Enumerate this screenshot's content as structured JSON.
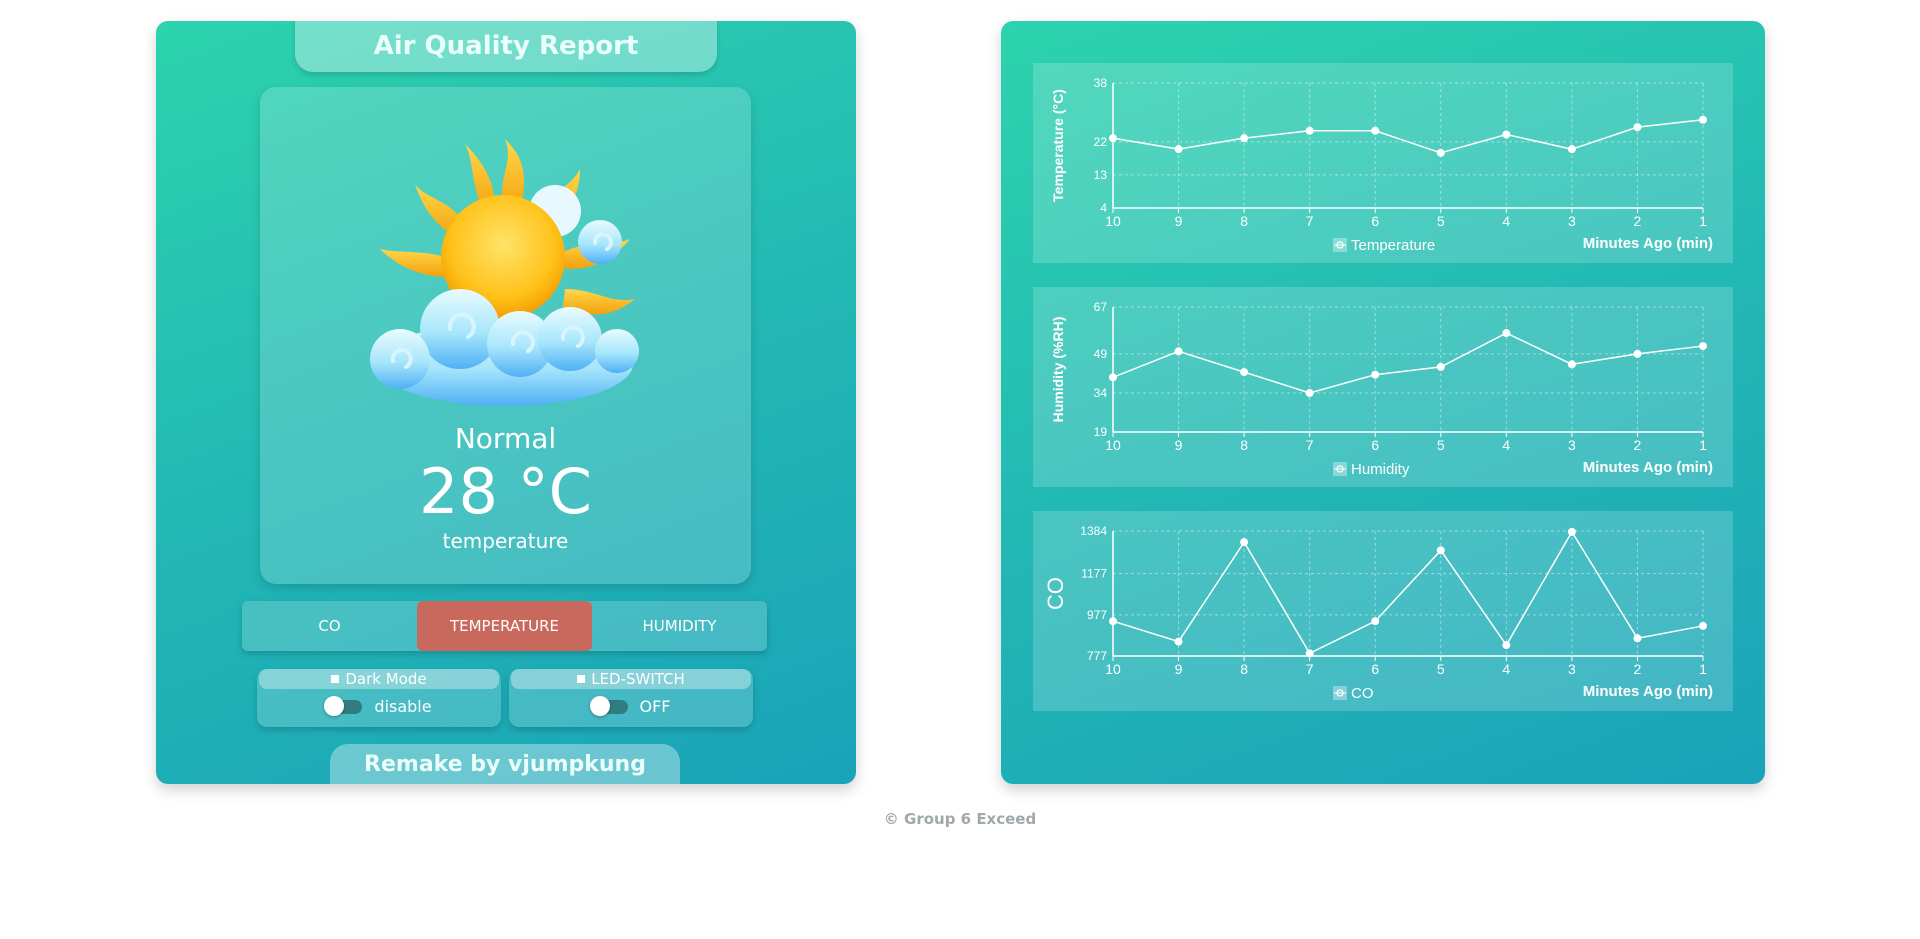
{
  "header": {
    "title": "Air Quality Report"
  },
  "weather": {
    "status": "Normal",
    "value": "28 °C",
    "label": "temperature",
    "icon": "sun-behind-cloud-icon"
  },
  "mode_tabs": [
    {
      "label": "CO",
      "active": false
    },
    {
      "label": "TEMPERATURE",
      "active": true
    },
    {
      "label": "HUMIDITY",
      "active": false
    }
  ],
  "switches": {
    "dark_mode": {
      "label": "Dark Mode",
      "state": "disable"
    },
    "led": {
      "label": "LED-SWITCH",
      "state": "OFF"
    }
  },
  "footer": {
    "label": "Remake by vjumpkung"
  },
  "copyright": "© Group 6 Exceed",
  "colors": {
    "panel_start": "#2dd3ae",
    "panel_end": "#1aa3b9",
    "active_tab": "#c9695d"
  },
  "chart_data": [
    {
      "type": "line",
      "x": [
        10,
        9,
        8,
        7,
        6,
        5,
        4,
        3,
        2,
        1
      ],
      "xlabel": "Minutes Ago (min)",
      "ylabel": "Temperature (°C)",
      "yticks": [
        4,
        13,
        22,
        38
      ],
      "ylim": [
        4,
        38
      ],
      "grid": true,
      "legend": "bottom-center",
      "series": [
        {
          "name": "Temperature",
          "values": [
            23,
            20,
            23,
            25,
            25,
            19,
            24,
            20,
            26,
            28
          ]
        }
      ]
    },
    {
      "type": "line",
      "x": [
        10,
        9,
        8,
        7,
        6,
        5,
        4,
        3,
        2,
        1
      ],
      "xlabel": "Minutes Ago (min)",
      "ylabel": "Humidity (%RH)",
      "yticks": [
        19,
        34,
        49,
        67
      ],
      "ylim": [
        19,
        67
      ],
      "grid": true,
      "legend": "bottom-center",
      "series": [
        {
          "name": "Humidity",
          "values": [
            40,
            50,
            42,
            34,
            41,
            44,
            57,
            45,
            49,
            52
          ]
        }
      ]
    },
    {
      "type": "line",
      "x": [
        10,
        9,
        8,
        7,
        6,
        5,
        4,
        3,
        2,
        1
      ],
      "xlabel": "Minutes Ago (min)",
      "ylabel": "CO",
      "yticks": [
        777,
        977,
        1177,
        1384
      ],
      "ylim": [
        777,
        1384
      ],
      "grid": true,
      "legend": "bottom-center",
      "series": [
        {
          "name": "CO",
          "values": [
            946,
            847,
            1330,
            790,
            946,
            1290,
            830,
            1380,
            863,
            923
          ]
        }
      ]
    }
  ]
}
